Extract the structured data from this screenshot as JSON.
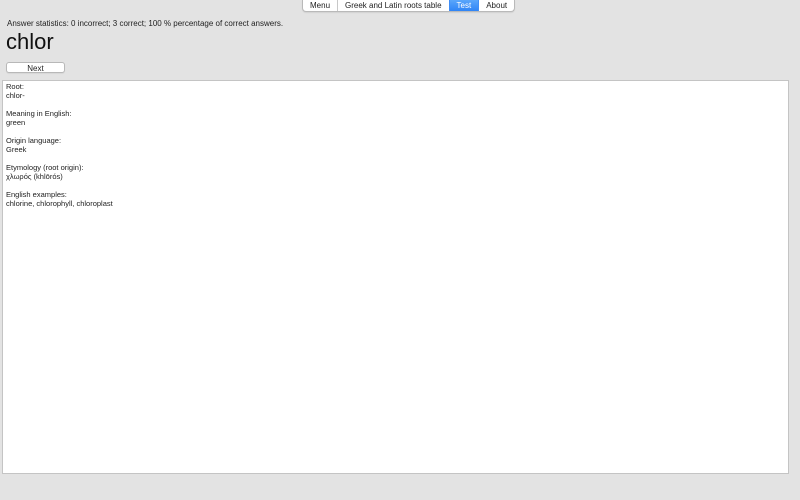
{
  "tabs": [
    {
      "label": "Menu",
      "active": false
    },
    {
      "label": "Greek and Latin roots table",
      "active": false
    },
    {
      "label": "Test",
      "active": true
    },
    {
      "label": "About",
      "active": false
    }
  ],
  "stats_text": "Answer statistics: 0 incorrect; 3 correct; 100 % percentage of correct answers.",
  "word": "chlor",
  "next_label": "Next",
  "details": {
    "root_label": "Root:",
    "root_value": "chlor-",
    "meaning_label": "Meaning in English:",
    "meaning_value": "green",
    "origin_label": "Origin language:",
    "origin_value": "Greek",
    "etymology_label": "Etymology (root origin):",
    "etymology_value": "χλωρός (khlōrós)",
    "examples_label": "English examples:",
    "examples_value": "chlorine, chlorophyll, chloroplast"
  },
  "colors": {
    "active_tab": "#3b8df7",
    "background": "#e3e3e3"
  }
}
